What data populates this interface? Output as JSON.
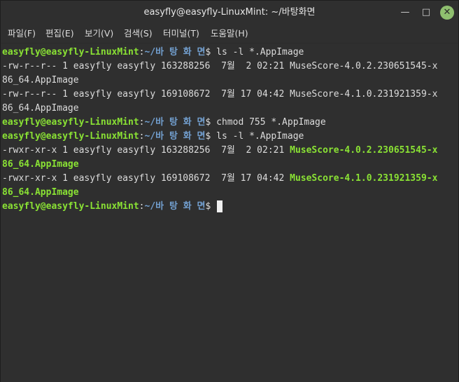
{
  "window": {
    "title": "easyfly@easyfly-LinuxMint: ~/바탕화면",
    "btn_min": "—",
    "btn_max": "□",
    "btn_close": "✕"
  },
  "menu": [
    "파일(F)",
    "편집(E)",
    "보기(V)",
    "검색(S)",
    "터미널(T)",
    "도움말(H)"
  ],
  "terminal": {
    "user_host": "easyfly@easyfly-LinuxMint",
    "sep": ":",
    "path": "~/바 탕 화 면",
    "dollar": "$ ",
    "cmd1": "ls -l *.AppImage",
    "out1a": "-rw-r--r-- 1 easyfly easyfly 163288256  7월  2 02:21 MuseScore-4.0.2.230651545-x",
    "out1b": "86_64.AppImage",
    "out2a": "-rw-r--r-- 1 easyfly easyfly 169108672  7월 17 04:42 MuseScore-4.1.0.231921359-x",
    "out2b": "86_64.AppImage",
    "cmd2": "chmod 755 *.AppImage",
    "cmd3": "ls -l *.AppImage",
    "out3_meta": "-rwxr-xr-x 1 easyfly easyfly 163288256  7월  2 02:21 ",
    "out3_file": "MuseScore-4.0.2.230651545-x",
    "out3_file2": "86_64.AppImage",
    "out4_meta": "-rwxr-xr-x 1 easyfly easyfly 169108672  7월 17 04:42 ",
    "out4_file": "MuseScore-4.1.0.231921359-x",
    "out4_file2": "86_64.AppImage"
  }
}
